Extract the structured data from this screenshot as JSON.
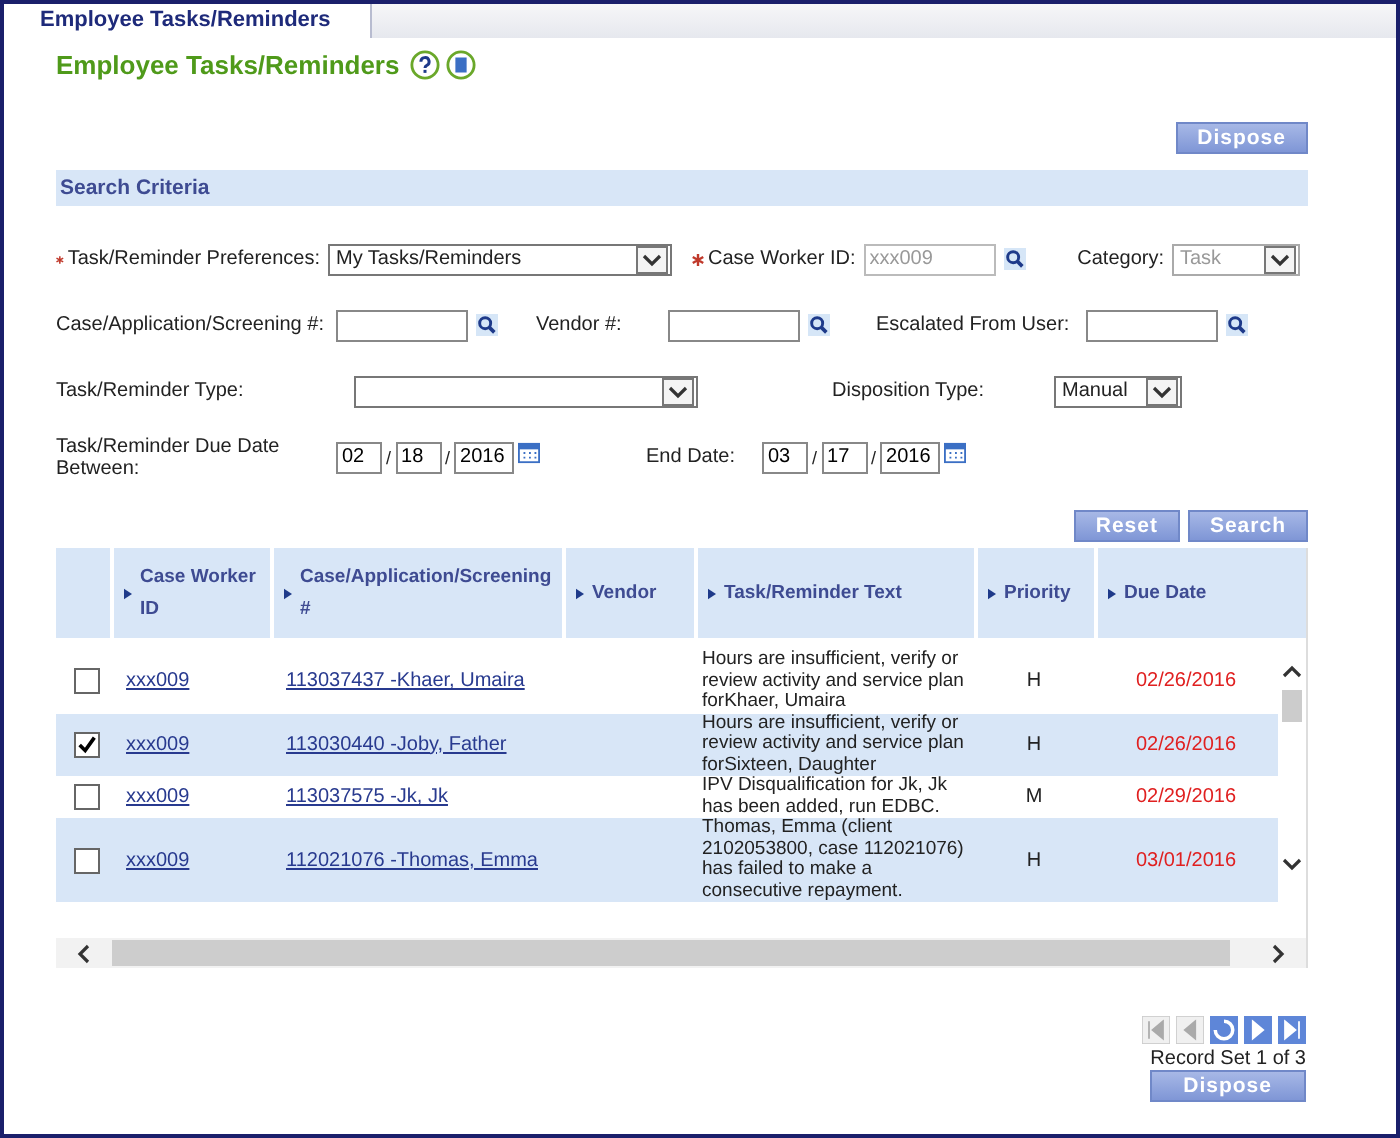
{
  "tabs": [
    {
      "label": "Employee Tasks/Reminders",
      "selected": true
    }
  ],
  "page_title": "Employee Tasks/Reminders",
  "dispose_button": "Dispose",
  "search_criteria": {
    "title": "Search Criteria",
    "rows": [
      [
        {
          "label": "Task/Reminder Preferences:",
          "required": true,
          "kind": "select",
          "value": "My Tasks/Reminders"
        },
        {
          "label": "Case Worker ID:",
          "required": true,
          "kind": "lookup",
          "value": "xxx009",
          "disabled": true
        },
        {
          "label": "Category:",
          "required": false,
          "kind": "select",
          "value": "Task",
          "disabled": true
        }
      ],
      [
        {
          "label": "Case/Application/Screening #:",
          "required": false,
          "kind": "lookup"
        },
        {
          "label": "Vendor #:",
          "required": false,
          "kind": "lookup"
        },
        {
          "label": "Escalated From User:",
          "required": false,
          "kind": "lookup"
        }
      ],
      [
        {
          "label": "Task/Reminder Type:",
          "required": false,
          "kind": "select"
        },
        {
          "label": "Disposition Type:",
          "required": false,
          "kind": "select",
          "value": "Manual"
        }
      ],
      [
        {
          "label": "Task/Reminder Due Date Between:",
          "required": false,
          "kind": "date",
          "parts": [
            "02",
            "18",
            "2016"
          ]
        },
        {
          "label": "End Date:",
          "required": false,
          "kind": "date",
          "parts": [
            "03",
            "17",
            "2016"
          ]
        }
      ]
    ],
    "date_separator": "/",
    "buttons": [
      "Reset",
      "Search"
    ]
  },
  "table": {
    "columns": [
      "Case Worker ID",
      "Case/Application/Screening #",
      "Vendor",
      "Task/Reminder Text",
      "Priority",
      "Due Date"
    ],
    "rows": [
      {
        "selected": false,
        "case_worker_id": "xxx009",
        "case": "113037437 -Khaer, Umaira",
        "text": "Hours are insufficient, verify or review activity and service plan forKhaer, Umaira",
        "priority": "H",
        "due_date": "02/26/2016"
      },
      {
        "selected": true,
        "case_worker_id": "xxx009",
        "case": "113030440 -Joby, Father",
        "text": "Hours are insufficient, verify or review activity and service plan forSixteen, Daughter",
        "priority": "H",
        "due_date": "02/26/2016"
      },
      {
        "selected": false,
        "case_worker_id": "xxx009",
        "case": "113037575 -Jk, Jk",
        "text": "IPV Disqualification for Jk, Jk has been added, run EDBC.",
        "priority": "M",
        "due_date": "02/29/2016"
      },
      {
        "selected": false,
        "case_worker_id": "xxx009",
        "case": "112021076 -Thomas, Emma",
        "text": "Thomas, Emma (client 2102053800, case 112021076) has failed to make a consecutive repayment.",
        "priority": "H",
        "due_date": "03/01/2016"
      }
    ]
  },
  "pager": {
    "buttons": [
      {
        "kind": "first",
        "disabled": true
      },
      {
        "kind": "previous",
        "disabled": true
      },
      {
        "kind": "refresh",
        "disabled": false
      },
      {
        "kind": "next",
        "disabled": false
      },
      {
        "kind": "last",
        "disabled": false
      }
    ],
    "record_set": "Record Set 1 of 3"
  },
  "bottom_button": "Dispose"
}
